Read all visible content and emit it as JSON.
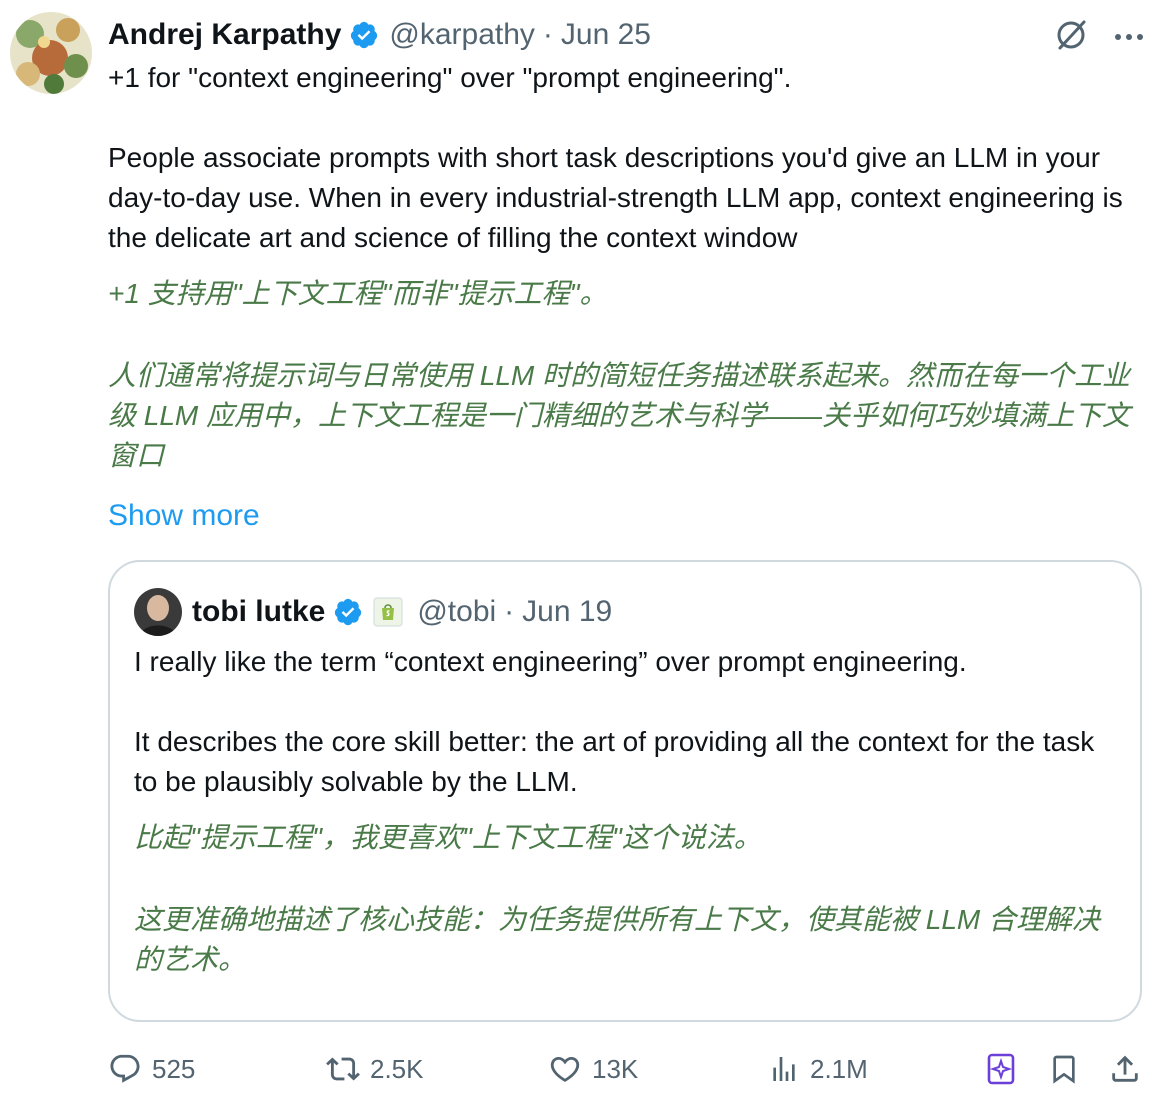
{
  "author": {
    "name": "Andrej Karpathy",
    "handle": "@karpathy",
    "separator": "·",
    "date": "Jun 25"
  },
  "tweet": {
    "line1": "+1 for \"context engineering\" over \"prompt engineering\".",
    "paragraph": "People associate prompts with short task descriptions you'd give an LLM in your day-to-day use. When in every industrial-strength LLM app, context engineering is the delicate art and science of filling the context window",
    "translation_line1": "+1 支持用\"上下文工程\"而非\"提示工程\"。",
    "translation_paragraph": "人们通常将提示词与日常使用 LLM 时的简短任务描述联系起来。然而在每一个工业级 LLM 应用中，上下文工程是一门精细的艺术与科学——关乎如何巧妙填满上下文窗口",
    "show_more": "Show more"
  },
  "quote": {
    "name": "tobi lutke",
    "handle": "@tobi",
    "separator": "·",
    "date": "Jun 19",
    "line1": "I really like the term “context engineering” over prompt engineering.",
    "paragraph": "It describes the core skill better: the art of providing all the context for the task to be plausibly solvable by the LLM.",
    "translation_line1": "比起\"提示工程\"，我更喜欢\"上下文工程\"这个说法。",
    "translation_paragraph": "这更准确地描述了核心技能：为任务提供所有上下文，使其能被 LLM 合理解决的艺术。"
  },
  "actions": {
    "replies": "525",
    "reposts": "2.5K",
    "likes": "13K",
    "views": "2.1M"
  },
  "colors": {
    "text": "#0f1419",
    "secondary": "#536471",
    "link": "#1d9bf0",
    "translation": "#4a7a48",
    "verified": "#1d9bf0",
    "border": "#cfd9de",
    "grok": "#6b3fd8"
  }
}
